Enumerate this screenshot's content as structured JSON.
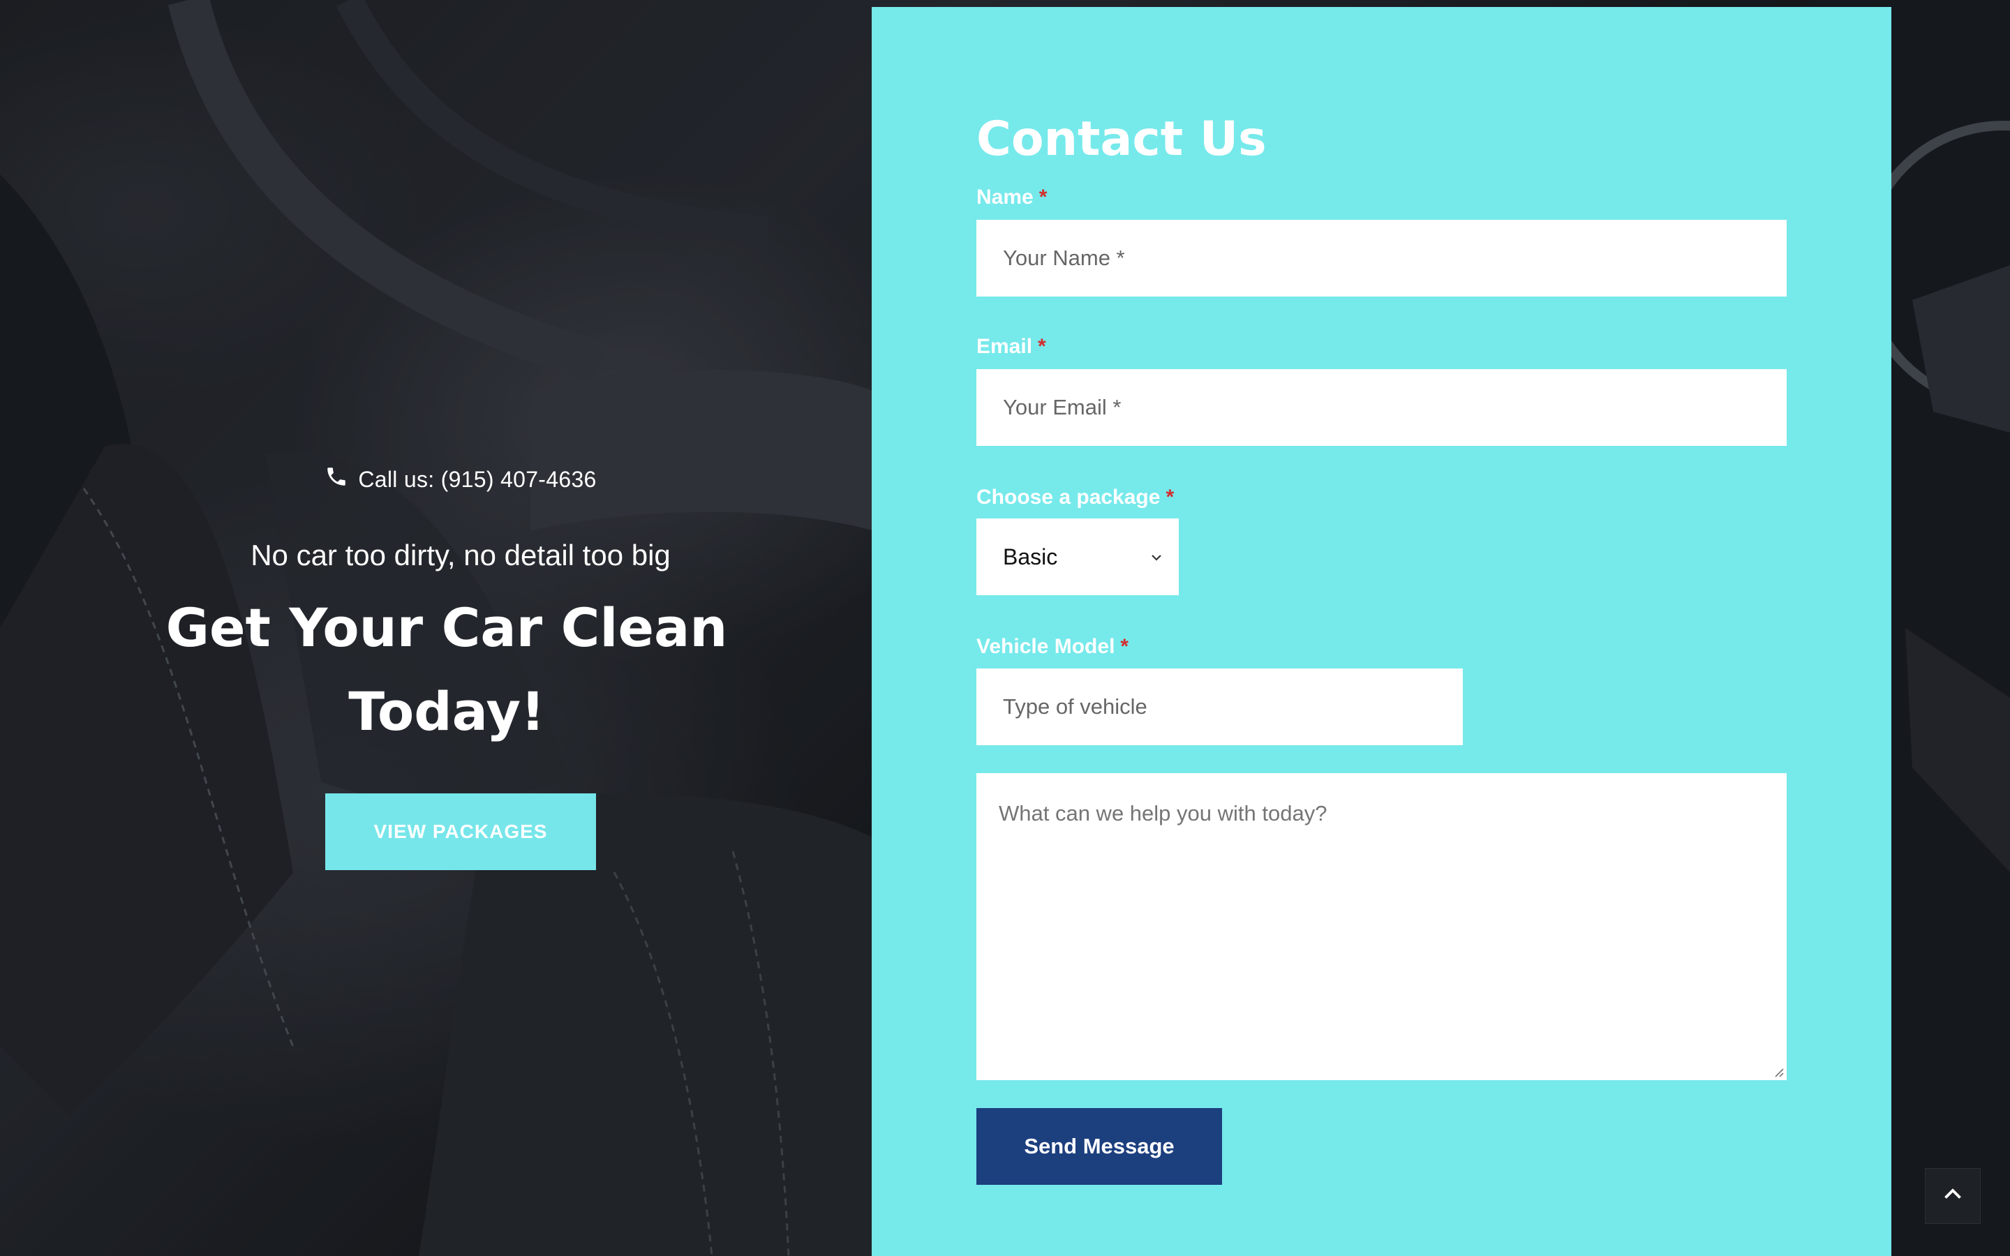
{
  "hero": {
    "call_text": "Call us: (915) 407-4636",
    "tagline": "No car too dirty, no detail too big",
    "headline_line1": "Get Your Car Clean",
    "headline_line2": "Today!",
    "cta_label": "VIEW PACKAGES"
  },
  "contact": {
    "title": "Contact Us",
    "required_marker": "*",
    "name_label": "Name",
    "name_placeholder": "Your Name *",
    "email_label": "Email",
    "email_placeholder": "Your Email *",
    "package_label": "Choose a package",
    "package_selected": "Basic",
    "vehicle_label": "Vehicle Model",
    "vehicle_placeholder": "Type of vehicle",
    "message_placeholder": "What can we help you with today?",
    "submit_label": "Send Message"
  },
  "colors": {
    "accent": "#76e9eb",
    "submit": "#1c3f7e",
    "required": "#d32f2f"
  },
  "icons": {
    "phone": "phone-icon",
    "select": "chevron-down-icon",
    "back_to_top": "chevron-up-icon"
  }
}
